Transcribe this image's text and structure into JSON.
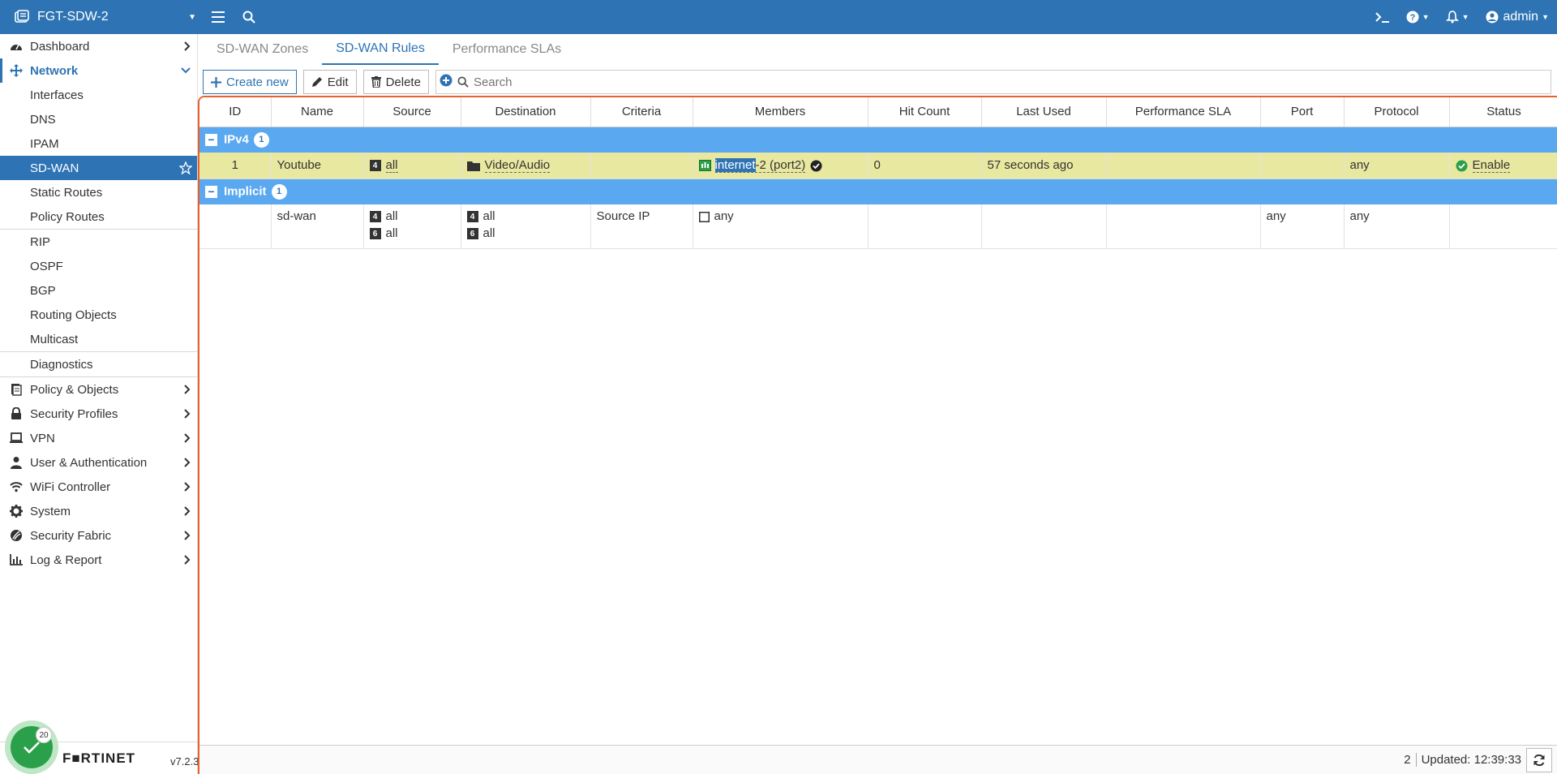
{
  "topbar": {
    "device_name": "FGT-SDW-2",
    "admin_label": "admin"
  },
  "sidebar": {
    "items": [
      {
        "label": "Dashboard",
        "icon": "dashboard-icon"
      },
      {
        "label": "Network",
        "icon": "network-icon"
      },
      {
        "label": "Interfaces"
      },
      {
        "label": "DNS"
      },
      {
        "label": "IPAM"
      },
      {
        "label": "SD-WAN"
      },
      {
        "label": "Static Routes"
      },
      {
        "label": "Policy Routes"
      },
      {
        "label": "RIP"
      },
      {
        "label": "OSPF"
      },
      {
        "label": "BGP"
      },
      {
        "label": "Routing Objects"
      },
      {
        "label": "Multicast"
      },
      {
        "label": "Diagnostics"
      },
      {
        "label": "Policy & Objects",
        "icon": "policy-icon"
      },
      {
        "label": "Security Profiles",
        "icon": "lock-icon"
      },
      {
        "label": "VPN",
        "icon": "laptop-icon"
      },
      {
        "label": "User & Authentication",
        "icon": "user-icon"
      },
      {
        "label": "WiFi Controller",
        "icon": "wifi-icon"
      },
      {
        "label": "System",
        "icon": "gear-icon"
      },
      {
        "label": "Security Fabric",
        "icon": "fabric-icon"
      },
      {
        "label": "Log & Report",
        "icon": "chart-icon"
      }
    ],
    "brand": "F■RTINET",
    "version": "v7.2.3",
    "health_count": "20"
  },
  "tabs": [
    "SD-WAN Zones",
    "SD-WAN Rules",
    "Performance SLAs"
  ],
  "toolbar": {
    "create_label": "Create new",
    "edit_label": "Edit",
    "delete_label": "Delete",
    "search_placeholder": "Search"
  },
  "table": {
    "columns": [
      "ID",
      "Name",
      "Source",
      "Destination",
      "Criteria",
      "Members",
      "Hit Count",
      "Last Used",
      "Performance SLA",
      "Port",
      "Protocol",
      "Status"
    ],
    "groups": [
      {
        "label": "IPv4",
        "count": "1"
      },
      {
        "label": "Implicit",
        "count": "1"
      }
    ],
    "rule1": {
      "id": "1",
      "name": "Youtube",
      "source_tag": "4",
      "source": "all",
      "destination": "Video/Audio",
      "criteria": "",
      "member_hl": "internet",
      "member_rest": "-2 (port2)",
      "hit_count": "0",
      "last_used": "57 seconds ago",
      "perf_sla": "",
      "port": "",
      "protocol": "any",
      "status": "Enable"
    },
    "implicit": {
      "name": "sd-wan",
      "source_tag4": "4",
      "source_tag6": "6",
      "source1": "all",
      "source2": "all",
      "dest1": "all",
      "dest2": "all",
      "criteria": "Source IP",
      "members": "any",
      "port": "any",
      "protocol": "any"
    }
  },
  "statusbar": {
    "count": "2",
    "updated": "Updated: 12:39:33"
  },
  "colors": {
    "brand_blue": "#2e74b5",
    "group_blue": "#5aa8f0",
    "row_highlight": "#e9e8a1",
    "focus_border": "#e8612c",
    "enable_green": "#2aa04a"
  }
}
